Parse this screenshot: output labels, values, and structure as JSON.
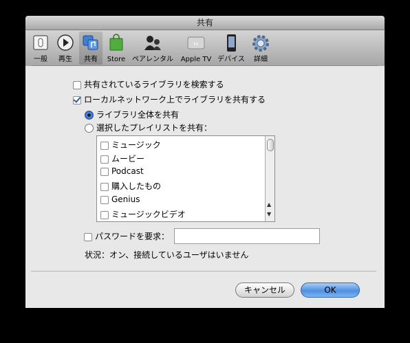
{
  "window": {
    "title": "共有"
  },
  "toolbar": {
    "items": [
      {
        "label": "一般",
        "icon": "general-switch-icon",
        "selected": false
      },
      {
        "label": "再生",
        "icon": "play-icon",
        "selected": false
      },
      {
        "label": "共有",
        "icon": "sharing-icon",
        "selected": true
      },
      {
        "label": "Store",
        "icon": "store-bag-icon",
        "selected": false
      },
      {
        "label": "ペアレンタル",
        "icon": "parental-icon",
        "selected": false
      },
      {
        "label": "Apple TV",
        "icon": "apple-tv-icon",
        "selected": false
      },
      {
        "label": "デバイス",
        "icon": "device-icon",
        "selected": false
      },
      {
        "label": "詳細",
        "icon": "gear-icon",
        "selected": false
      }
    ]
  },
  "options": {
    "search_shared": {
      "label": "共有されているライブラリを検索する",
      "checked": false
    },
    "share_library": {
      "label": "ローカルネットワーク上でライブラリを共有する",
      "checked": true
    },
    "share_all": {
      "label": "ライブラリ全体を共有",
      "selected": true
    },
    "share_selected": {
      "label": "選択したプレイリストを共有：",
      "selected": false
    }
  },
  "playlists": [
    {
      "label": "ミュージック",
      "checked": false
    },
    {
      "label": "ムービー",
      "checked": false
    },
    {
      "label": "Podcast",
      "checked": false
    },
    {
      "label": "購入したもの",
      "checked": false
    },
    {
      "label": "Genius",
      "checked": false
    },
    {
      "label": "ミュージックビデオ",
      "checked": false
    }
  ],
  "password": {
    "label": "パスワードを要求：",
    "checked": false,
    "value": ""
  },
  "status": {
    "text": "状況：オン、接続しているユーザはいません"
  },
  "buttons": {
    "cancel": "キャンセル",
    "ok": "OK"
  },
  "colors": {
    "accent": "#4f8fe2",
    "window_bg": "#e8e8e8"
  }
}
